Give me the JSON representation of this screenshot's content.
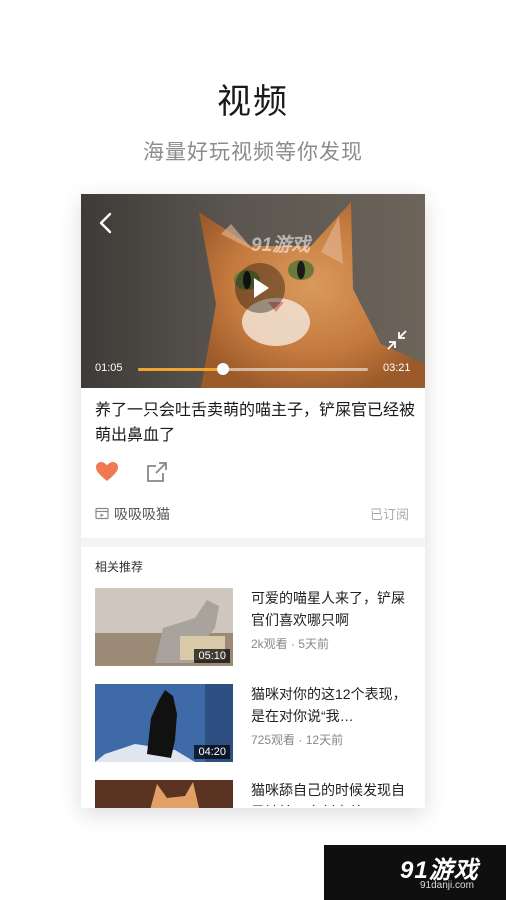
{
  "hero": {
    "title": "视频",
    "subtitle": "海量好玩视频等你发现"
  },
  "player": {
    "current_time": "01:05",
    "total_time": "03:21",
    "progress": 0.37,
    "watermark": "91游戏"
  },
  "video": {
    "title": "养了一只会吐舌卖萌的喵主子，铲屎官已经被萌出鼻血了"
  },
  "channel": {
    "name": "吸吸吸猫",
    "subscribe_status": "已订阅"
  },
  "recommend": {
    "header": "相关推荐",
    "items": [
      {
        "title": "可爱的喵星人来了，铲屎官们喜欢哪只啊",
        "views": "2k观看",
        "time": "5天前",
        "duration": "05:10"
      },
      {
        "title": "猫咪对你的这12个表现，是在对你说“我…",
        "views": "725观看",
        "time": "12天前",
        "duration": "04:20"
      },
      {
        "title": "猫咪舔自己的时候发现自己被拍，立刻害羞",
        "views": "",
        "time": "",
        "duration": ""
      }
    ]
  },
  "watermark": {
    "logo": "91游戏",
    "url": "91danji.com"
  },
  "colors": {
    "accent": "#f0a431",
    "like": "#ef7a52"
  }
}
